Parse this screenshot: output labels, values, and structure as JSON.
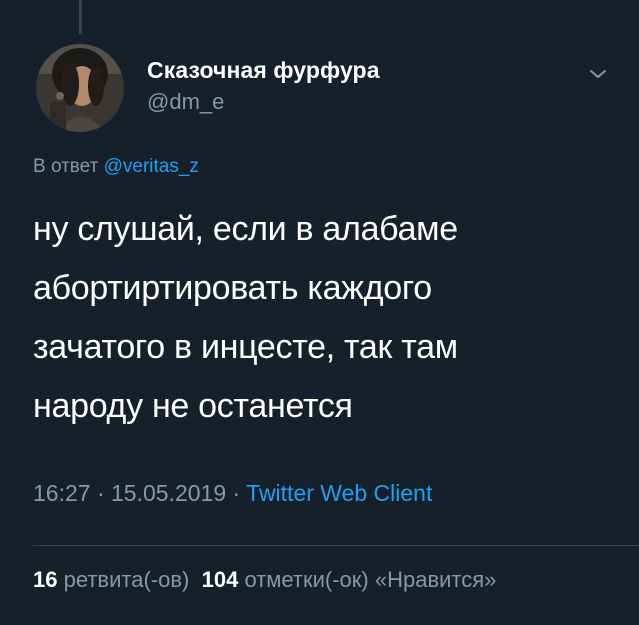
{
  "tweet": {
    "author": {
      "display_name": "Сказочная фурфура",
      "handle": "@dm_e",
      "avatar_icon": "user-avatar"
    },
    "menu_icon": "chevron-down-icon",
    "reply": {
      "prefix": "В ответ",
      "mention": "@veritas_z"
    },
    "text_lines": [
      "ну слушай, если в алабаме",
      "абортиртировать каждого",
      "зачатого в инцесте, так там",
      "народу не останется"
    ],
    "meta": {
      "time": "16:27",
      "sep1": " · ",
      "date": "15.05.2019",
      "sep2": " · ",
      "client": "Twitter Web Client"
    },
    "stats": {
      "retweets_count": "16",
      "retweets_label": "ретвита(-ов)",
      "likes_count": "104",
      "likes_label": "отметки(-ок) «Нравится»"
    }
  },
  "colors": {
    "background": "#15202b",
    "text": "#ffffff",
    "secondary": "#8899a6",
    "accent": "#1da1f2",
    "border": "#38444d"
  }
}
